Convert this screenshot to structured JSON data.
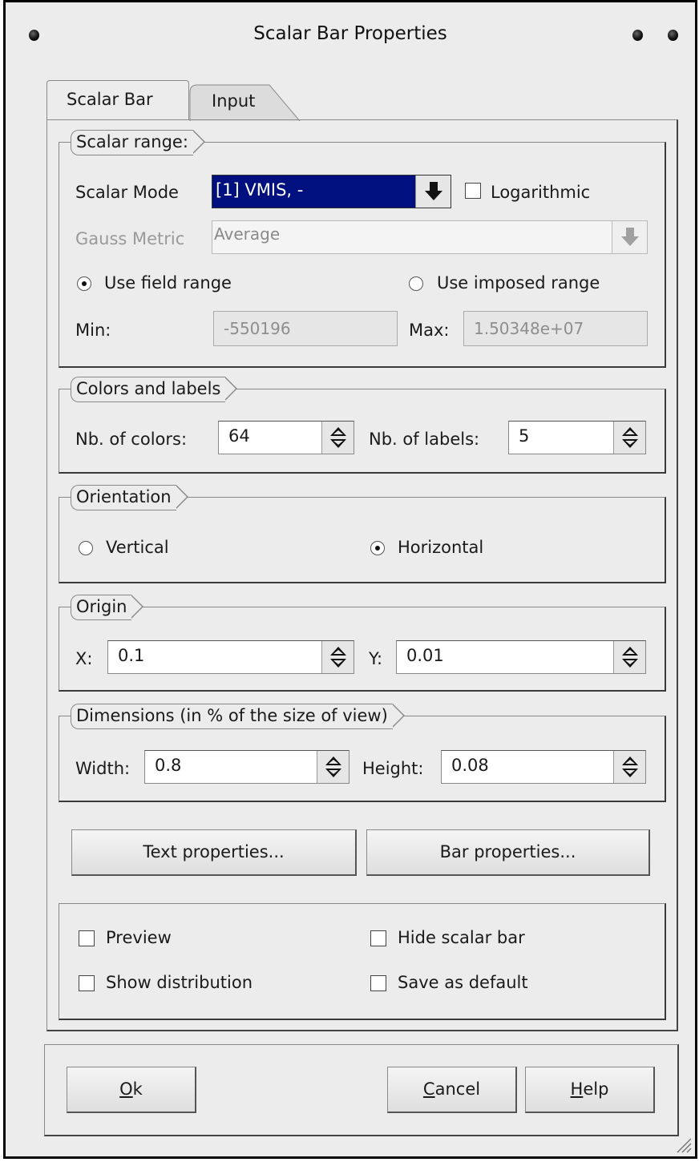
{
  "window": {
    "title": "Scalar Bar Properties"
  },
  "tabs": [
    {
      "label": "Scalar Bar"
    },
    {
      "label": "Input"
    }
  ],
  "scalar_range": {
    "legend": "Scalar range:",
    "scalar_mode_label": "Scalar Mode",
    "scalar_mode_value": "[1] VMIS, -",
    "logarithmic_label": "Logarithmic",
    "gauss_metric_label": "Gauss Metric",
    "gauss_metric_value": "Average",
    "use_field_range_label": "Use field range",
    "use_imposed_range_label": "Use imposed range",
    "min_label": "Min:",
    "min_value": "-550196",
    "max_label": "Max:",
    "max_value": "1.50348e+07"
  },
  "colors_labels": {
    "legend": "Colors and labels",
    "nb_colors_label": "Nb. of colors:",
    "nb_colors_value": "64",
    "nb_labels_label": "Nb. of labels:",
    "nb_labels_value": "5"
  },
  "orientation": {
    "legend": "Orientation",
    "vertical_label": "Vertical",
    "horizontal_label": "Horizontal",
    "selected": "Horizontal"
  },
  "origin": {
    "legend": "Origin",
    "x_label": "X:",
    "x_value": "0.1",
    "y_label": "Y:",
    "y_value": "0.01"
  },
  "dimensions": {
    "legend": "Dimensions (in % of the size of view)",
    "width_label": "Width:",
    "width_value": "0.8",
    "height_label": "Height:",
    "height_value": "0.08"
  },
  "actions": {
    "text_properties": "Text properties...",
    "bar_properties": "Bar properties..."
  },
  "options": {
    "preview": "Preview",
    "hide_scalar_bar": "Hide scalar bar",
    "show_distribution": "Show distribution",
    "save_as_default": "Save as default"
  },
  "buttons": {
    "ok_mnemonic": "O",
    "ok_rest": "k",
    "cancel_mnemonic": "C",
    "cancel_rest": "ancel",
    "help_mnemonic": "H",
    "help_rest": "elp"
  },
  "icons": {
    "title_left": "window-menu-dot-icon",
    "title_right": "window-control-dot-icon",
    "combo": "arrow-down-icon",
    "spin": "spin-updown-icon",
    "resize": "resize-grip-icon"
  }
}
